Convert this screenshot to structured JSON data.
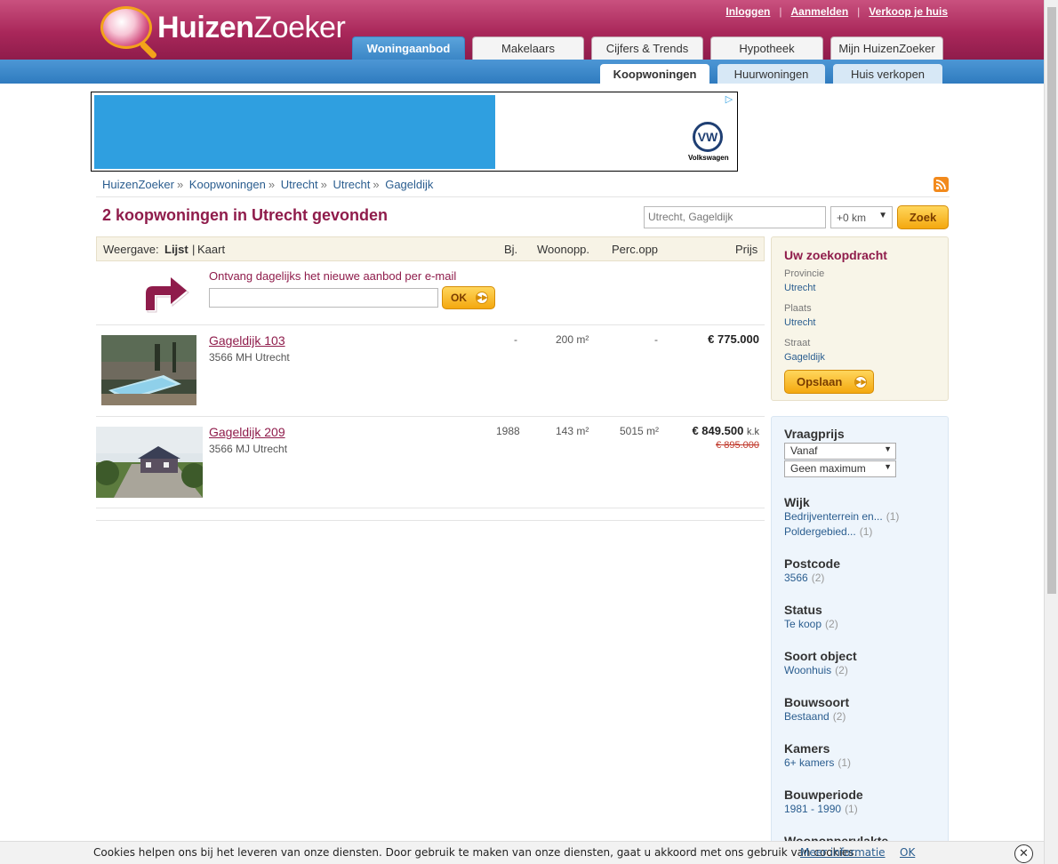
{
  "header": {
    "logo_bold": "Huizen",
    "logo_light": "Zoeker",
    "top_links": [
      "Inloggen",
      "Aanmelden",
      "Verkoop je huis"
    ],
    "main_tabs": [
      "Woningaanbod",
      "Makelaars",
      "Cijfers & Trends",
      "Hypotheek",
      "Mijn HuizenZoeker"
    ],
    "sub_tabs": [
      "Koopwoningen",
      "Huurwoningen",
      "Huis verkopen"
    ]
  },
  "ad": {
    "brand": "Volkswagen",
    "logo_glyph": "VW",
    "adchoices_glyph": "▷"
  },
  "breadcrumb": [
    "HuizenZoeker",
    "Koopwoningen",
    "Utrecht",
    "Utrecht",
    "Gageldijk"
  ],
  "rss_icon": "rss-icon",
  "page_title": "2 koopwoningen in Utrecht gevonden",
  "search": {
    "value": "Utrecht, Gageldijk",
    "radius": "+0 km",
    "button": "Zoek"
  },
  "results_header": {
    "view_label": "Weergave:",
    "list": "Lijst",
    "sep": "|",
    "map": "Kaart",
    "col_year": "Bj.",
    "col_area": "Woonopp.",
    "col_plot": "Perc.opp",
    "col_price": "Prijs"
  },
  "mail_alert": {
    "title": "Ontvang dagelijks het nieuwe aanbod per e-mail",
    "button": "OK"
  },
  "listings": [
    {
      "address": "Gageldijk 103",
      "zip": "3566 MH Utrecht",
      "year": "-",
      "area": "200 m²",
      "plot": "-",
      "price": "€ 775.000",
      "price_suffix": "",
      "old_price": ""
    },
    {
      "address": "Gageldijk 209",
      "zip": "3566 MJ Utrecht",
      "year": "1988",
      "area": "143 m²",
      "plot": "5015 m²",
      "price": "€ 849.500",
      "price_suffix": "k.k",
      "old_price": "€ 895.000"
    }
  ],
  "search_summary": {
    "title": "Uw zoekopdracht",
    "province_label": "Provincie",
    "province": "Utrecht",
    "city_label": "Plaats",
    "city": "Utrecht",
    "street_label": "Straat",
    "street": "Gageldijk",
    "button": "Opslaan"
  },
  "filters": {
    "price_title": "Vraagprijs",
    "price_from": "Vanaf",
    "price_to": "Geen maximum",
    "groups": [
      {
        "title": "Wijk",
        "items": [
          {
            "label": "Bedrijventerrein en...",
            "count": "(1)"
          },
          {
            "label": "Poldergebied...",
            "count": "(1)"
          }
        ]
      },
      {
        "title": "Postcode",
        "items": [
          {
            "label": "3566",
            "count": "(2)"
          }
        ]
      },
      {
        "title": "Status",
        "items": [
          {
            "label": "Te koop",
            "count": "(2)"
          }
        ]
      },
      {
        "title": "Soort object",
        "items": [
          {
            "label": "Woonhuis",
            "count": "(2)"
          }
        ]
      },
      {
        "title": "Bouwsoort",
        "items": [
          {
            "label": "Bestaand",
            "count": "(2)"
          }
        ]
      },
      {
        "title": "Kamers",
        "items": [
          {
            "label": "6+ kamers",
            "count": "(1)"
          }
        ]
      },
      {
        "title": "Bouwperiode",
        "items": [
          {
            "label": "1981 - 1990",
            "count": "(1)"
          }
        ]
      },
      {
        "title": "Woonoppervlakte",
        "items": []
      }
    ]
  },
  "cookie": {
    "text": "Cookies helpen ons bij het leveren van onze diensten. Door gebruik te maken van onze diensten, gaat u akkoord met ons gebruik van cookies.",
    "more": "Meer informatie",
    "ok": "OK",
    "close_glyph": "✕"
  }
}
